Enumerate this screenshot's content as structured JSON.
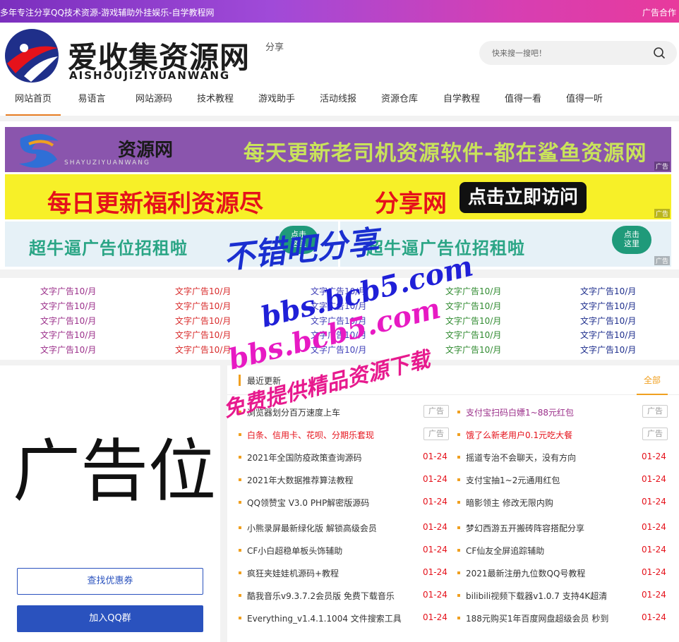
{
  "topbar": {
    "slogan": "多年专注分享QQ技术资源-游戏辅助外挂娱乐-自学教程网",
    "ad_link": "广告合作"
  },
  "header": {
    "logo_title": "爱收集资源网",
    "logo_sub": "AISHOUJIZIYUANWANG",
    "logo_extra": "分享",
    "search_placeholder": "快来搜一搜吧！"
  },
  "nav": [
    {
      "label": "网站首页",
      "active": true
    },
    {
      "label": "易语言"
    },
    {
      "label": "网站源码"
    },
    {
      "label": "技术教程"
    },
    {
      "label": "游戏助手"
    },
    {
      "label": "活动线报"
    },
    {
      "label": "资源仓库"
    },
    {
      "label": "自学教程"
    },
    {
      "label": "值得一看"
    },
    {
      "label": "值得一听"
    }
  ],
  "banners": {
    "b1_name": "资源网",
    "b1_sub": "SHAYUZIYUANWANG",
    "b1_text": "每天更新老司机资源软件-都在鲨鱼资源网",
    "b2_text": "每日更新福利资源尽",
    "b2_text2": "分享网",
    "b2_button": "点击立即访问",
    "b3_text": "超牛逼广告位招租啦",
    "b3_bubble": "点击\n这里",
    "ad_tag": "广告"
  },
  "text_ads": {
    "label": "文字广告10/月"
  },
  "left_ad": {
    "big_text": "广告位",
    "coupon_button": "查找优惠券",
    "qq_button": "加入QQ群"
  },
  "latest": {
    "title": "最近更新",
    "all_label": "全部",
    "ad_tag": "广告",
    "left_items": [
      {
        "title": "浏览器划分百万速度上车",
        "date": "广告",
        "tag": true
      },
      {
        "title": "白条、信用卡、花呗、分期乐套现",
        "date": "广告",
        "tag": true
      },
      {
        "title": "2021年全国防疫政策查询源码",
        "date": "01-24"
      },
      {
        "title": "2021年大数据推荐算法教程",
        "date": "01-24"
      },
      {
        "title": "QQ领赞宝 V3.0 PHP解密版源码",
        "date": "01-24"
      },
      {
        "title": "小熊录屏最新绿化版 解锁高级会员",
        "date": "01-24"
      },
      {
        "title": "CF小白超稳单板头饰辅助",
        "date": "01-24"
      },
      {
        "title": "疯狂夹娃娃机源码+教程",
        "date": "01-24"
      },
      {
        "title": "酷我音乐v9.3.7.2会员版 免费下载音乐",
        "date": "01-24"
      },
      {
        "title": "Everything_v1.4.1.1004 文件搜索工具",
        "date": "01-24"
      }
    ],
    "right_items": [
      {
        "title": "支付宝扫码白嫖1~88元红包",
        "date": "广告",
        "tag": true
      },
      {
        "title": "饿了么新老用户0.1元吃大餐",
        "date": "广告",
        "tag": true
      },
      {
        "title": "摇道专治不会聊天，没有方向",
        "date": "01-24"
      },
      {
        "title": "支付宝抽1~2元通用红包",
        "date": "01-24"
      },
      {
        "title": "暗影领主 修改无限内购",
        "date": "01-24"
      },
      {
        "title": "梦幻西游五开搬砖阵容搭配分享",
        "date": "01-24"
      },
      {
        "title": "CF仙友全屏追踪辅助",
        "date": "01-24"
      },
      {
        "title": "2021最新注册九位数QQ号教程",
        "date": "01-24"
      },
      {
        "title": "bilibili视频下载器v1.0.7 支持4K超清",
        "date": "01-24"
      },
      {
        "title": "188元购买1年百度网盘超级会员 秒到",
        "date": "01-24"
      }
    ]
  },
  "watermark": {
    "line1": "不错吧分享",
    "line2": "bbs.bcb5.com",
    "line3": "bbs.bcb5.com",
    "line4": "免费提供精品资源下载"
  },
  "colors": {
    "topbar_start": "#7b2fbe",
    "topbar_end": "#e83a9c",
    "accent": "#f0a020",
    "date_red": "#e5121b",
    "button_blue": "#2a52be"
  }
}
